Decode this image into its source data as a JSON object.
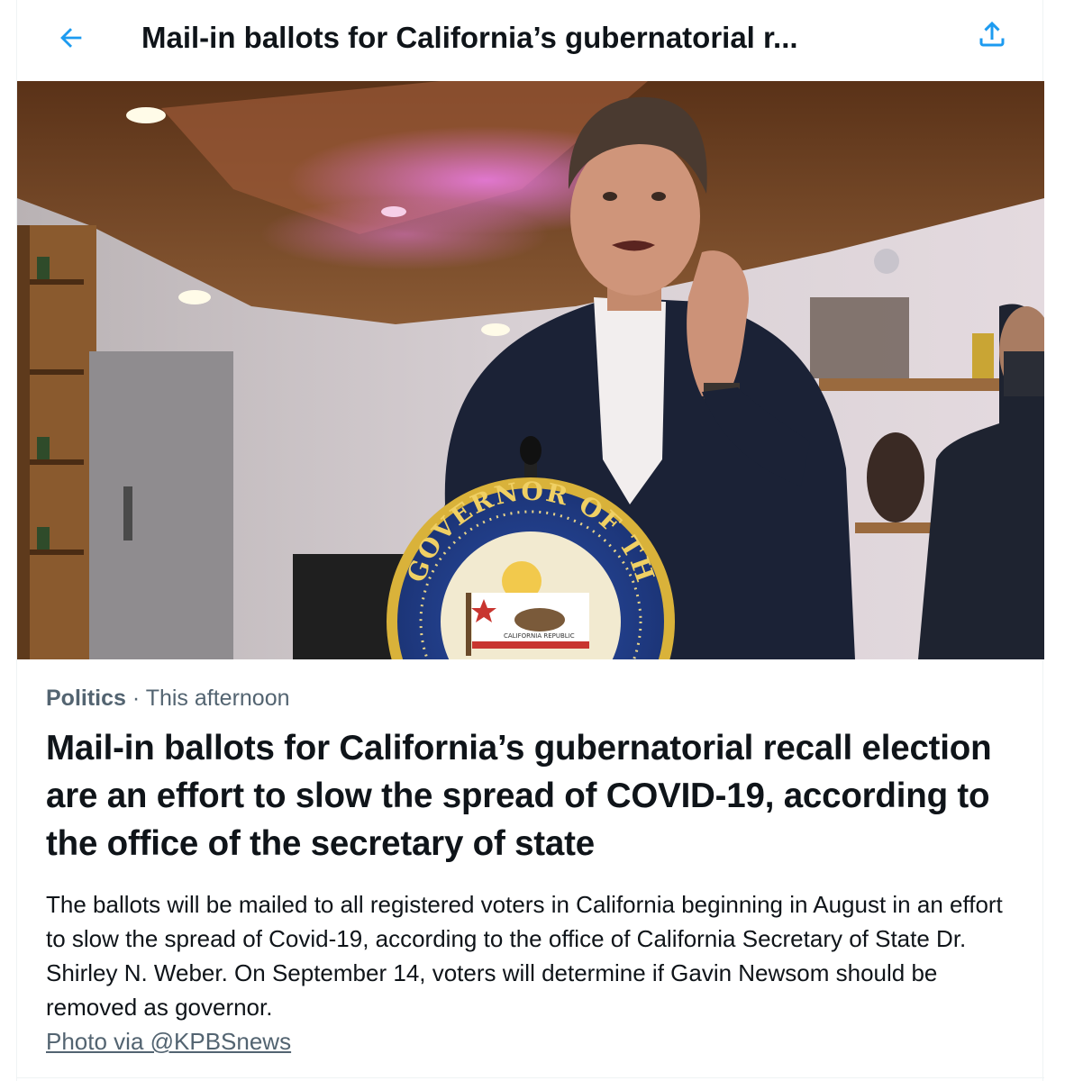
{
  "header": {
    "title": "Mail-in ballots for California’s gubernatorial r...",
    "back_icon": "arrow-left-icon",
    "share_icon": "share-upload-icon",
    "accent_color": "#1d9bf0"
  },
  "photo": {
    "seal_text": "GOVERNOR OF THE STATE OF CALIFORNIA",
    "seal_top_text": "OF THE",
    "flag_text": "CALIFORNIA REPUBLIC",
    "seal_side_text": "OF THE"
  },
  "article": {
    "category": "Politics",
    "separator": "·",
    "time": "This afternoon",
    "headline": "Mail-in ballots for California’s gubernatorial recall election are an effort to slow the spread of COVID-19, according to the office of the secretary of state",
    "summary": "The ballots will be mailed to all registered voters in California beginning in August in an effort to slow the spread of Covid-19, according to the office of California Secretary of State Dr. Shirley N. Weber. On September 14, voters will determine if Gavin Newsom should be removed as governor.",
    "credit": "Photo via @KPBSnews"
  }
}
